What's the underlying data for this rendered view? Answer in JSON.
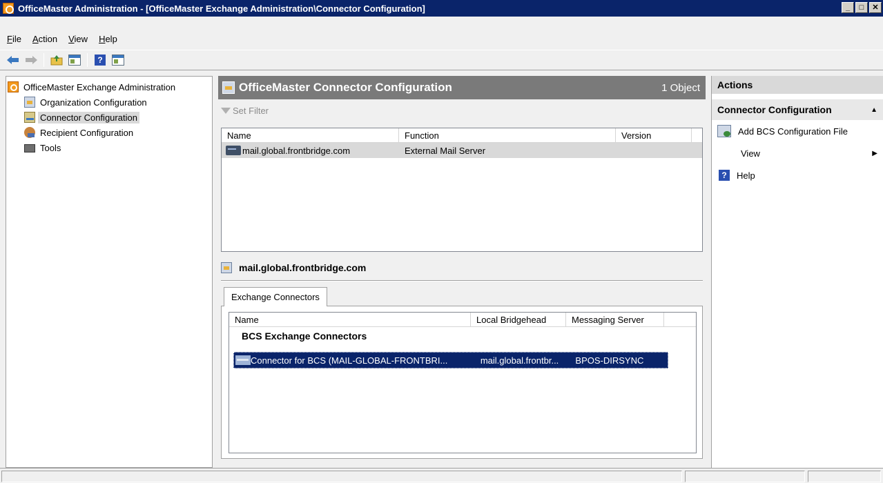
{
  "window": {
    "title": "OfficeMaster Administration - [OfficeMaster Exchange Administration\\Connector Configuration]",
    "controls": [
      "_",
      "□",
      "✕"
    ]
  },
  "menu": {
    "items": [
      "File",
      "Action",
      "View",
      "Help"
    ]
  },
  "tree": {
    "root": "OfficeMaster Exchange Administration",
    "items": [
      {
        "label": "Organization Configuration"
      },
      {
        "label": "Connector Configuration",
        "selected": true
      },
      {
        "label": "Recipient Configuration"
      },
      {
        "label": "Tools"
      }
    ]
  },
  "center": {
    "header_title": "OfficeMaster Connector Configuration",
    "header_count": "1 Object",
    "filter_label": "Set Filter",
    "top_columns": [
      "Name",
      "Function",
      "Version"
    ],
    "top_rows": [
      {
        "name": "mail.global.frontbridge.com",
        "function": "External Mail Server",
        "version": ""
      }
    ],
    "detail_title": "mail.global.frontbridge.com",
    "tab_label": "Exchange Connectors",
    "bottom_columns": [
      "Name",
      "Local Bridgehead",
      "Messaging Server"
    ],
    "group_title": "BCS Exchange Connectors",
    "bottom_rows": [
      {
        "name": "Connector for BCS (MAIL-GLOBAL-FRONTBRI...",
        "bridgehead": "mail.global.frontbr...",
        "server": "BPOS-DIRSYNC"
      }
    ]
  },
  "actions": {
    "title": "Actions",
    "section": "Connector Configuration",
    "items": [
      {
        "label": "Add BCS Configuration File",
        "icon": "add-config-icon"
      },
      {
        "label": "View",
        "icon": "",
        "submenu": true
      },
      {
        "label": "Help",
        "icon": "help-icon"
      }
    ]
  },
  "colors": {
    "titlebar": "#0a246a",
    "header_bar": "#7a7a7a",
    "selection": "#0a246a"
  }
}
